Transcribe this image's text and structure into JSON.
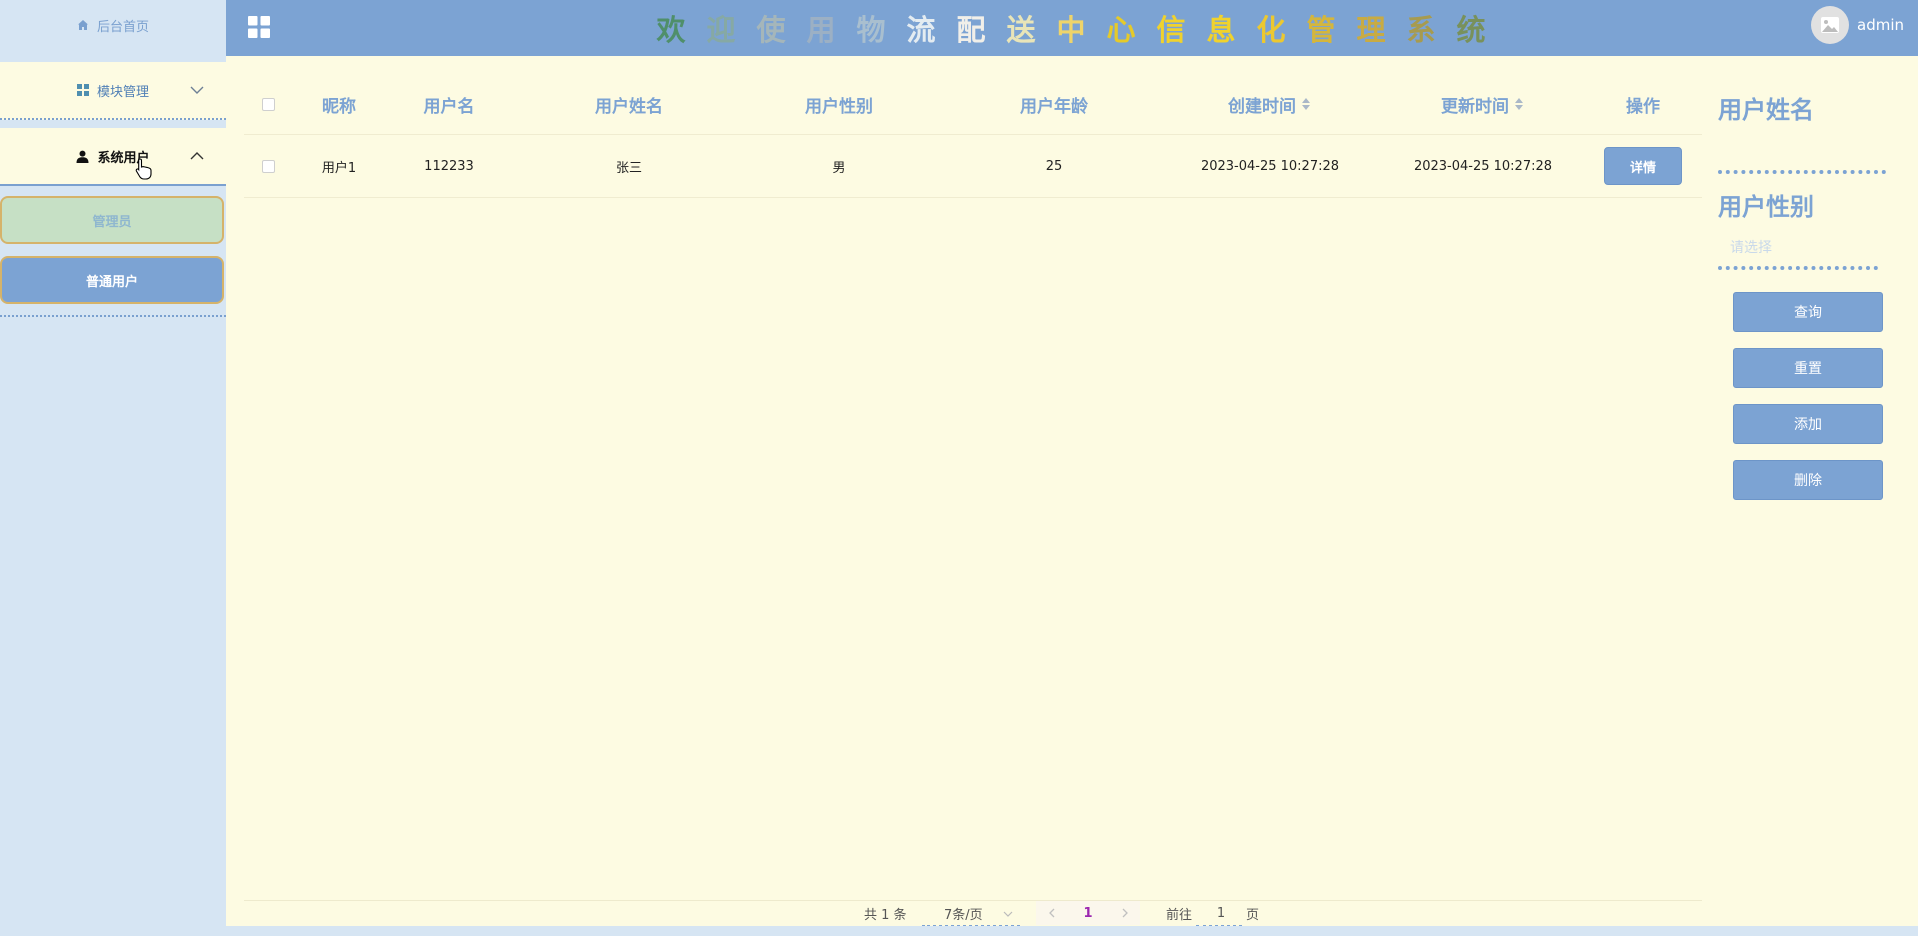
{
  "sidebar": {
    "home": {
      "label": "后台首页",
      "icon": "home-icon"
    },
    "module_mgmt": {
      "label": "模块管理",
      "icon": "grid-icon",
      "expanded": false
    },
    "system_users": {
      "label": "系统用户",
      "icon": "user-icon",
      "expanded": true
    },
    "sub_items": [
      {
        "label": "管理员"
      },
      {
        "label": "普通用户",
        "active": true
      }
    ]
  },
  "header": {
    "title_chars": [
      {
        "ch": "欢",
        "color": "#4f8f6a"
      },
      {
        "ch": "迎",
        "color": "#86a9a4"
      },
      {
        "ch": "使",
        "color": "#a5b6ba"
      },
      {
        "ch": "用",
        "color": "#9cb0c4"
      },
      {
        "ch": "物",
        "color": "#a9bfcf"
      },
      {
        "ch": "流",
        "color": "#e4ecf1"
      },
      {
        "ch": "配",
        "color": "#f1efe9"
      },
      {
        "ch": "送",
        "color": "#e9e5b8"
      },
      {
        "ch": "中",
        "color": "#eed46b"
      },
      {
        "ch": "心",
        "color": "#e5ca2a"
      },
      {
        "ch": "信",
        "color": "#f0d22c"
      },
      {
        "ch": "息",
        "color": "#f0d22c"
      },
      {
        "ch": "化",
        "color": "#ecc830"
      },
      {
        "ch": "管",
        "color": "#d4b63d"
      },
      {
        "ch": "理",
        "color": "#c8ab43"
      },
      {
        "ch": "系",
        "color": "#a79b4f"
      },
      {
        "ch": "统",
        "color": "#78915b"
      }
    ],
    "username": "admin"
  },
  "table": {
    "headers": {
      "nickname": "昵称",
      "username": "用户名",
      "realname": "用户姓名",
      "gender": "用户性别",
      "age": "用户年龄",
      "created": "创建时间",
      "updated": "更新时间",
      "action": "操作"
    },
    "rows": [
      {
        "nickname": "用户1",
        "username": "112233",
        "realname": "张三",
        "gender": "男",
        "age": "25",
        "created": "2023-04-25 10:27:28",
        "updated": "2023-04-25 10:27:28",
        "action_label": "详情"
      }
    ]
  },
  "filters": {
    "realname_label": "用户姓名",
    "gender_label": "用户性别",
    "gender_placeholder": "请选择",
    "buttons": {
      "query": "查询",
      "reset": "重置",
      "add": "添加",
      "delete": "删除"
    }
  },
  "pagination": {
    "total": "共 1 条",
    "page_size": "7条/页",
    "current_page": "1",
    "goto_prefix": "前往",
    "goto_value": "1",
    "goto_suffix": "页"
  },
  "colors": {
    "accent": "#7ca3d3",
    "sidebar_bg": "#d6e5f3",
    "content_bg": "#fdfbe2",
    "page_active": "#9c27b0"
  }
}
